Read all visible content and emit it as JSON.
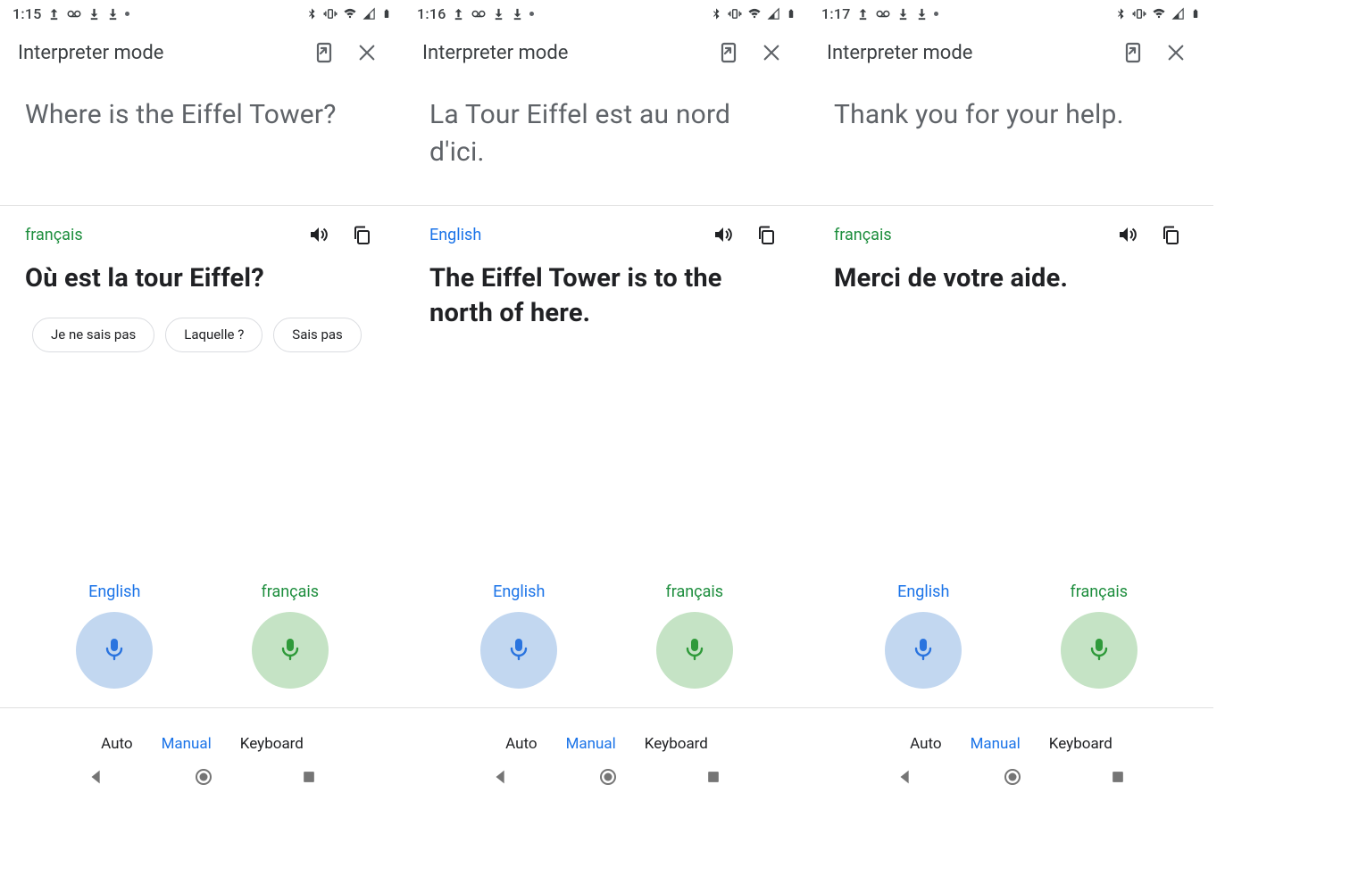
{
  "screens": [
    {
      "time": "1:15",
      "title": "Interpreter mode",
      "source_text": "Where is the Eiffel Tower?",
      "target_lang_label": "français",
      "target_lang_color": "green",
      "translation": "Où est la tour Eiffel?",
      "suggestions": [
        "Je ne sais pas",
        "Laquelle ?",
        "Sais pas"
      ],
      "mic_left_label": "English",
      "mic_right_label": "français",
      "modes": {
        "auto": "Auto",
        "manual": "Manual",
        "keyboard": "Keyboard"
      }
    },
    {
      "time": "1:16",
      "title": "Interpreter mode",
      "source_text": "La Tour Eiffel est au nord d'ici.",
      "target_lang_label": "English",
      "target_lang_color": "blue",
      "translation": "The Eiffel Tower is to the north of here.",
      "suggestions": [],
      "mic_left_label": "English",
      "mic_right_label": "français",
      "modes": {
        "auto": "Auto",
        "manual": "Manual",
        "keyboard": "Keyboard"
      }
    },
    {
      "time": "1:17",
      "title": "Interpreter mode",
      "source_text": "Thank you for your help.",
      "target_lang_label": "français",
      "target_lang_color": "green",
      "translation": "Merci de votre aide.",
      "suggestions": [],
      "mic_left_label": "English",
      "mic_right_label": "français",
      "modes": {
        "auto": "Auto",
        "manual": "Manual",
        "keyboard": "Keyboard"
      }
    }
  ]
}
